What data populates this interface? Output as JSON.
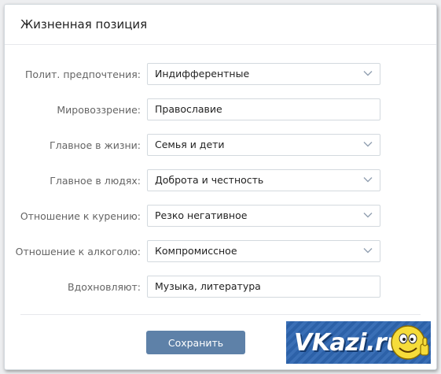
{
  "panel": {
    "title": "Жизненная позиция"
  },
  "fields": [
    {
      "label": "Полит. предпочтения:",
      "value": "Индифферентные",
      "type": "select"
    },
    {
      "label": "Мировоззрение:",
      "value": "Православие",
      "type": "text"
    },
    {
      "label": "Главное в жизни:",
      "value": "Семья и дети",
      "type": "select"
    },
    {
      "label": "Главное в людях:",
      "value": "Доброта и честность",
      "type": "select"
    },
    {
      "label": "Отношение к курению:",
      "value": "Резко негативное",
      "type": "select"
    },
    {
      "label": "Отношение к алкоголю:",
      "value": "Компромиссное",
      "type": "select"
    },
    {
      "label": "Вдохновляют:",
      "value": "Музыка, литература",
      "type": "text"
    }
  ],
  "actions": {
    "save_label": "Сохранить"
  },
  "watermark": {
    "text": "VKazi.ru"
  },
  "colors": {
    "button": "#5e81a8",
    "label": "#656565",
    "border": "#d3d9de",
    "watermark_bg": "#2e66b1"
  },
  "icons": {
    "select_arrow": "chevron-down-icon",
    "mascot": "smiley-thumbs-up-icon"
  }
}
